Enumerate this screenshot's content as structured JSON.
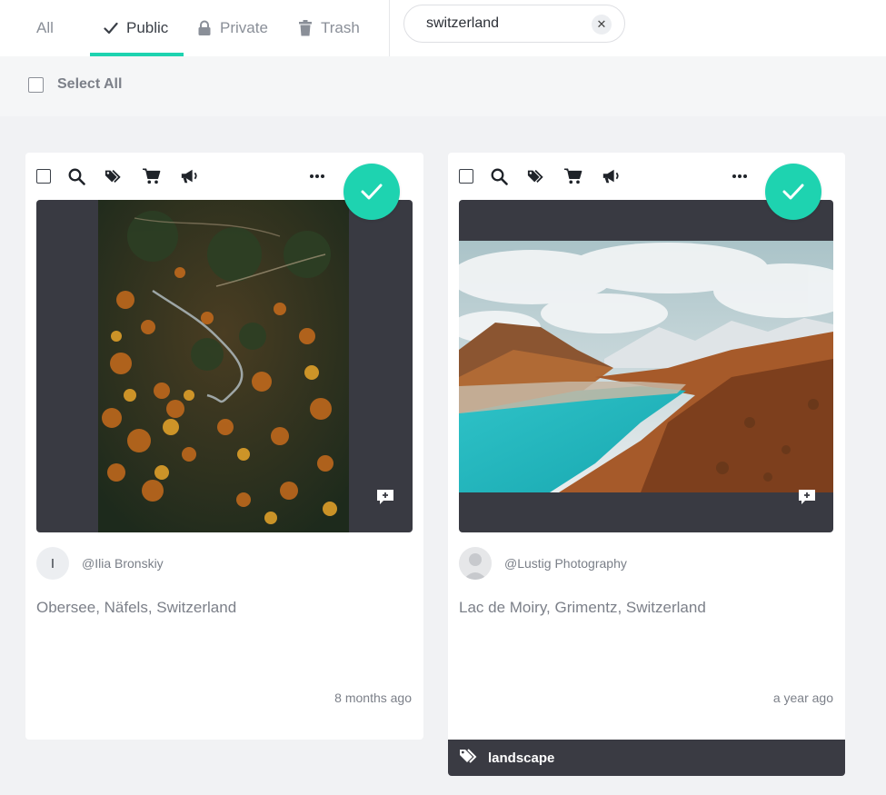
{
  "tabs": [
    {
      "label": "All",
      "icon": "none",
      "active": false
    },
    {
      "label": "Public",
      "icon": "check-icon",
      "active": true
    },
    {
      "label": "Private",
      "icon": "lock-icon",
      "active": false
    },
    {
      "label": "Trash",
      "icon": "trash-icon",
      "active": false
    }
  ],
  "search": {
    "value": "switzerland",
    "clear_icon": "close-icon"
  },
  "select_all": {
    "label": "Select All",
    "checked": false
  },
  "colors": {
    "accent": "#1ed3b0",
    "dark": "#393a42",
    "muted": "#7c8089"
  },
  "cards": [
    {
      "toolbar_icons": [
        "checkbox",
        "search-icon",
        "tag-icon",
        "cart-icon",
        "megaphone-icon",
        "more-icon"
      ],
      "selected": true,
      "owner": {
        "initial": "I",
        "name": "@Ilia Bronskiy"
      },
      "title": "Obersee, Näfels, Switzerland",
      "time": "8 months ago",
      "tags": []
    },
    {
      "toolbar_icons": [
        "checkbox",
        "search-icon",
        "tag-icon",
        "cart-icon",
        "megaphone-icon",
        "more-icon"
      ],
      "selected": true,
      "owner": {
        "initial": "",
        "name": "@Lustig Photography"
      },
      "title": "Lac de Moiry, Grimentz, Switzerland",
      "time": "a year ago",
      "tags": [
        "landscape"
      ]
    }
  ]
}
